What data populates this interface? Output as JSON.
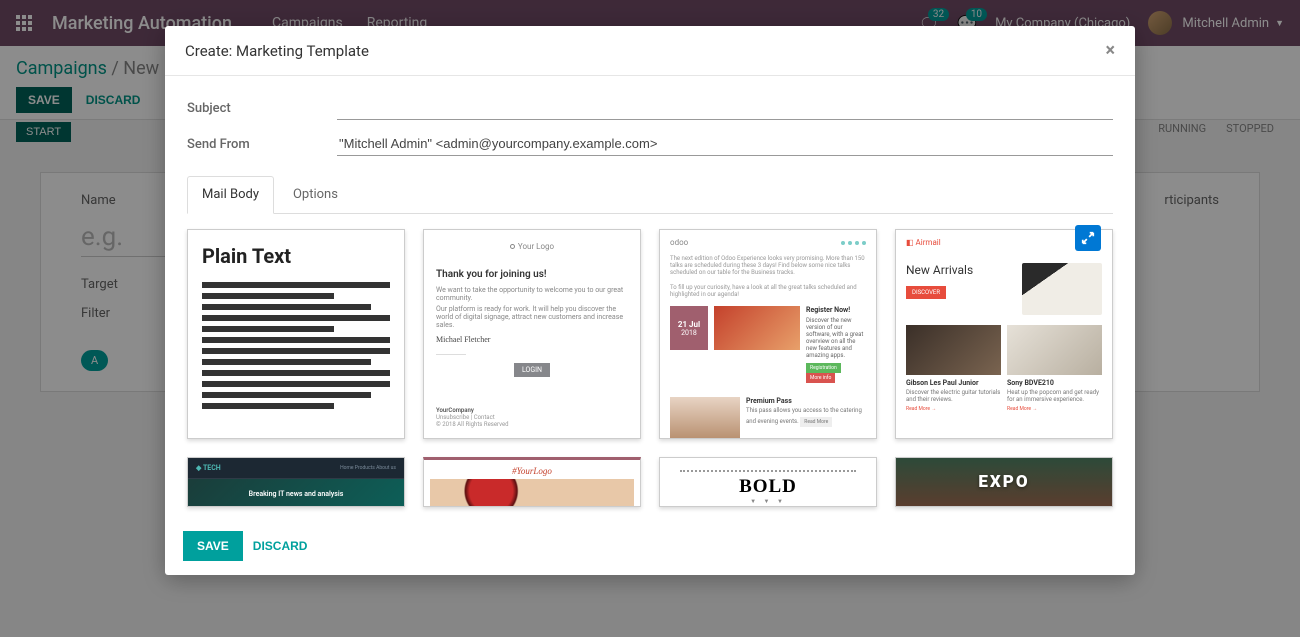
{
  "header": {
    "brand": "Marketing Automation",
    "nav": [
      "Campaigns",
      "Reporting"
    ],
    "msg_badge1": "32",
    "msg_badge2": "10",
    "company": "My Company (Chicago)",
    "user": "Mitchell Admin"
  },
  "breadcrumb": {
    "root": "Campaigns",
    "current": "New"
  },
  "page_buttons": {
    "save": "SAVE",
    "discard": "DISCARD",
    "start": "START"
  },
  "status_chips": [
    "RUNNING",
    "STOPPED"
  ],
  "bg_form": {
    "name_label": "Name",
    "name_placeholder": "e.g.",
    "target_label": "Target",
    "filter_label": "Filter",
    "pill": "A",
    "participants_label": "rticipants"
  },
  "modal": {
    "title": "Create: Marketing Template",
    "subject_label": "Subject",
    "subject_value": "",
    "from_label": "Send From",
    "from_value": "\"Mitchell Admin\" <admin@yourcompany.example.com>",
    "tabs": {
      "mailbody": "Mail Body",
      "options": "Options"
    },
    "footer": {
      "save": "SAVE",
      "discard": "DISCARD"
    }
  },
  "thumbs": {
    "plain_heading": "Plain Text",
    "thanks": {
      "logo": "Your Logo",
      "heading": "Thank you for joining us!",
      "line1": "We want to take the opportunity to welcome you to our great community.",
      "line2": "Our platform is ready for work. It will help you discover the world of digital signage, attract new customers and increase sales.",
      "name": "Michael Fletcher",
      "button": "LOGIN",
      "company": "YourCompany",
      "footer": "Unsubscribe | Contact",
      "footer2": "© 2018 All Rights Reserved"
    },
    "odoo": {
      "brand": "odoo",
      "intro": "The next edition of Odoo Experience looks very promising. More than 150 talks are scheduled during these 3 days! Find below some nice talks scheduled on our table for the Business tracks.",
      "intro2": "To fill up your curiosity, have a look at all the great talks scheduled and highlighted in our agenda!",
      "date_day": "21 Jul",
      "date_year": "2018",
      "reg_h": "Register Now!",
      "reg_p": "Discover the new version of our software, with a great overview on all the new features and amazing apps.",
      "tag1": "Registration",
      "tag2": "More info",
      "pp_h": "Premium Pass",
      "pp_p": "This pass allows you access to the catering and evening events.",
      "pp_btn": "Read More"
    },
    "airmail": {
      "brand": "Airmail",
      "heading": "New Arrivals",
      "discover": "DISCOVER",
      "prod1_name": "Gibson Les Paul Junior",
      "prod1_desc": "Discover the electric guitar tutorials and their reviews.",
      "prod2_name": "Sony BDVE210",
      "prod2_desc": "Heat up the popcorn and get ready for an immersive experience.",
      "read_more": "Read More →"
    },
    "tech": {
      "brand": "◆ TECH",
      "nav": "Home   Products   About us",
      "headline": "Breaking IT news and analysis"
    },
    "food": {
      "logo": "#YourLogo"
    },
    "bold": {
      "title": "BOLD"
    },
    "expo": {
      "title": "EXPO"
    }
  }
}
